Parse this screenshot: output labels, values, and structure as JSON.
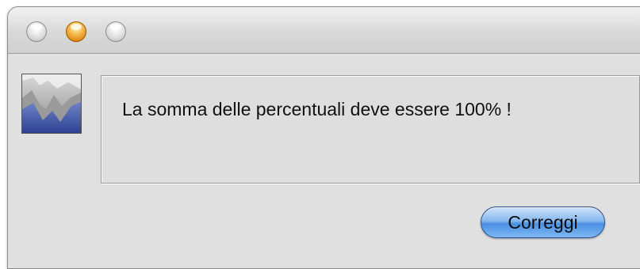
{
  "dialog": {
    "message": "La somma delle percentuali deve essere 100% !",
    "button_label": "Correggi",
    "icon": "application-icon"
  },
  "window_controls": {
    "close": "close-icon",
    "minimize": "minimize-icon",
    "zoom": "zoom-icon"
  },
  "colors": {
    "window_bg": "#e0e0e0",
    "button_accent": "#4a90e0",
    "minimize_button": "#e08a10"
  }
}
